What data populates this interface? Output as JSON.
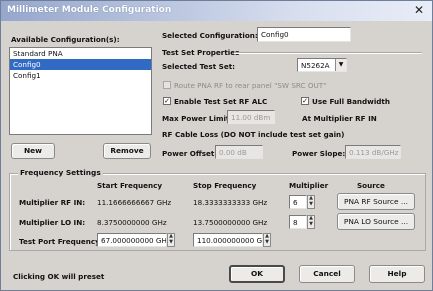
{
  "window": {
    "title": "Millimeter Module Configuration",
    "close_glyph": "✕"
  },
  "available": {
    "label": "Available Configuration(s):",
    "items": [
      "Standard PNA",
      "Config0",
      "Config1"
    ],
    "new_label": "New",
    "remove_label": "Remove"
  },
  "selected": {
    "label": "Selected Configuration:",
    "value": "Config0"
  },
  "test_set": {
    "group_label": "Test Set Properties",
    "selected_label": "Selected Test Set:",
    "selected_value": "N5262A",
    "route_label": "Route PNA RF to rear panel \"SW SRC OUT\"",
    "alc_label": "Enable Test Set RF ALC",
    "bandwidth_label": "Use Full Bandwidth",
    "max_power_label": "Max Power Limit:",
    "max_power_value": "11.00 dBm",
    "at_multiplier_label": "At Multiplier RF IN"
  },
  "cable_loss": {
    "label": "RF Cable Loss (DO NOT include test set gain)",
    "power_offset_label": "Power Offset:",
    "power_offset_value": "0.00 dB",
    "power_slope_label": "Power Slope:",
    "power_slope_value": "0.113 dB/GHz"
  },
  "frequency": {
    "group_label": "Frequency Settings",
    "col_start": "Start Frequency",
    "col_stop": "Stop Frequency",
    "col_multiplier": "Multiplier",
    "col_source": "Source",
    "rf_label": "Multiplier RF IN:",
    "rf_start": "11.1666666667 GHz",
    "rf_stop": "18.3333333333 GHz",
    "rf_multiplier": "6",
    "rf_source": "PNA RF Source ...",
    "lo_label": "Multiplier LO IN:",
    "lo_start": "8.3750000000 GHz",
    "lo_stop": "13.7500000000 GHz",
    "lo_multiplier": "8",
    "lo_source": "PNA LO Source ...",
    "port_label": "Test Port Frequency:",
    "port_start": "67.000000000 GHz",
    "port_stop": "110.000000000 GI"
  },
  "footer": {
    "note": "Clicking OK will preset",
    "ok_label": "OK",
    "cancel_label": "Cancel",
    "help_label": "Help"
  },
  "icons": {
    "checkmark": "✓",
    "spin_up": "▲",
    "spin_down": "▼",
    "dropdown": "▼"
  }
}
